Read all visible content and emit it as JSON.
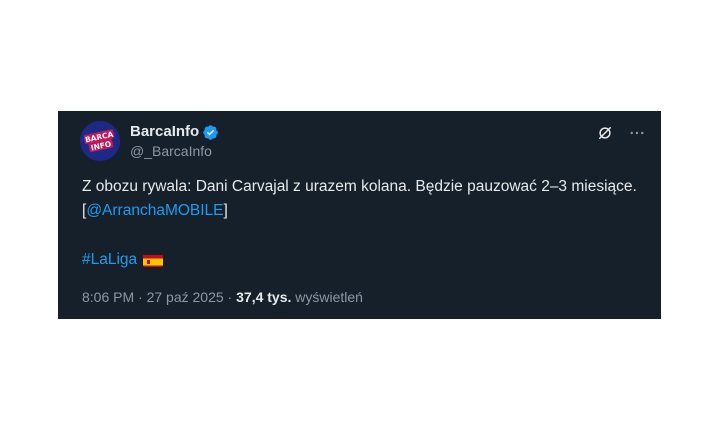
{
  "author": {
    "display_name": "BarcaInfo",
    "handle": "@_BarcaInfo",
    "avatar_text": "BARCA INFO",
    "verified": true
  },
  "tweet": {
    "text_prefix": "Z obozu rywala: Dani Carvajal z urazem kolana. Będzie pauzować 2–3 miesiące. [",
    "mention": "@ArranchaMOBILE",
    "text_suffix": "]",
    "hashtag": "#LaLiga",
    "flag_emoji_name": "spain-flag-icon"
  },
  "meta": {
    "time": "8:06 PM",
    "separator1": " · ",
    "date": "27 paź 2025",
    "separator2": " · ",
    "views_count": "37,4 tys.",
    "views_label": " wyświetleń"
  },
  "icons": {
    "grok": "grok-icon",
    "more": "more-icon"
  },
  "colors": {
    "card_bg": "#15202b",
    "link": "#1d9bf0",
    "text": "#e7e9ea",
    "muted": "#8b98a5",
    "verified": "#1d9bf0"
  }
}
